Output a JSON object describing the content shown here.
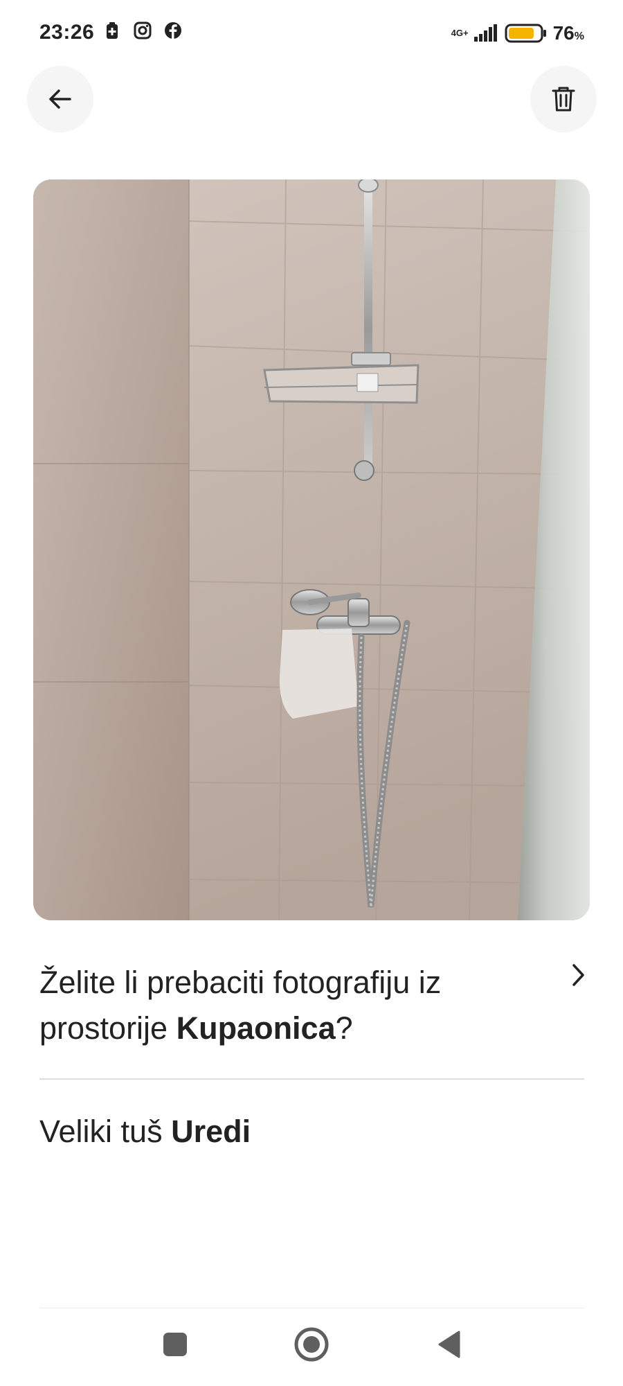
{
  "status_bar": {
    "time": "23:26",
    "network": "4G+",
    "battery_percent": "76",
    "battery_unit": "%",
    "left_icons": [
      "battery-saver-icon",
      "instagram-icon",
      "facebook-icon"
    ]
  },
  "header": {
    "back_icon": "arrow-left-icon",
    "delete_icon": "trash-icon"
  },
  "photo": {
    "subject": "shower"
  },
  "question": {
    "text_before": "Želite li prebaciti fotografiju iz prostorije ",
    "room_name": "Kupaonica",
    "text_after": "?"
  },
  "caption": {
    "text": "Veliki tuš ",
    "edit_label": "Uredi"
  },
  "nav_bar": {
    "icons": [
      "recents-icon",
      "home-icon",
      "back-triangle-icon"
    ]
  },
  "colors": {
    "text": "#222222",
    "button_bg": "#f5f5f5",
    "divider": "#dddddd",
    "battery": "#f4b400"
  }
}
